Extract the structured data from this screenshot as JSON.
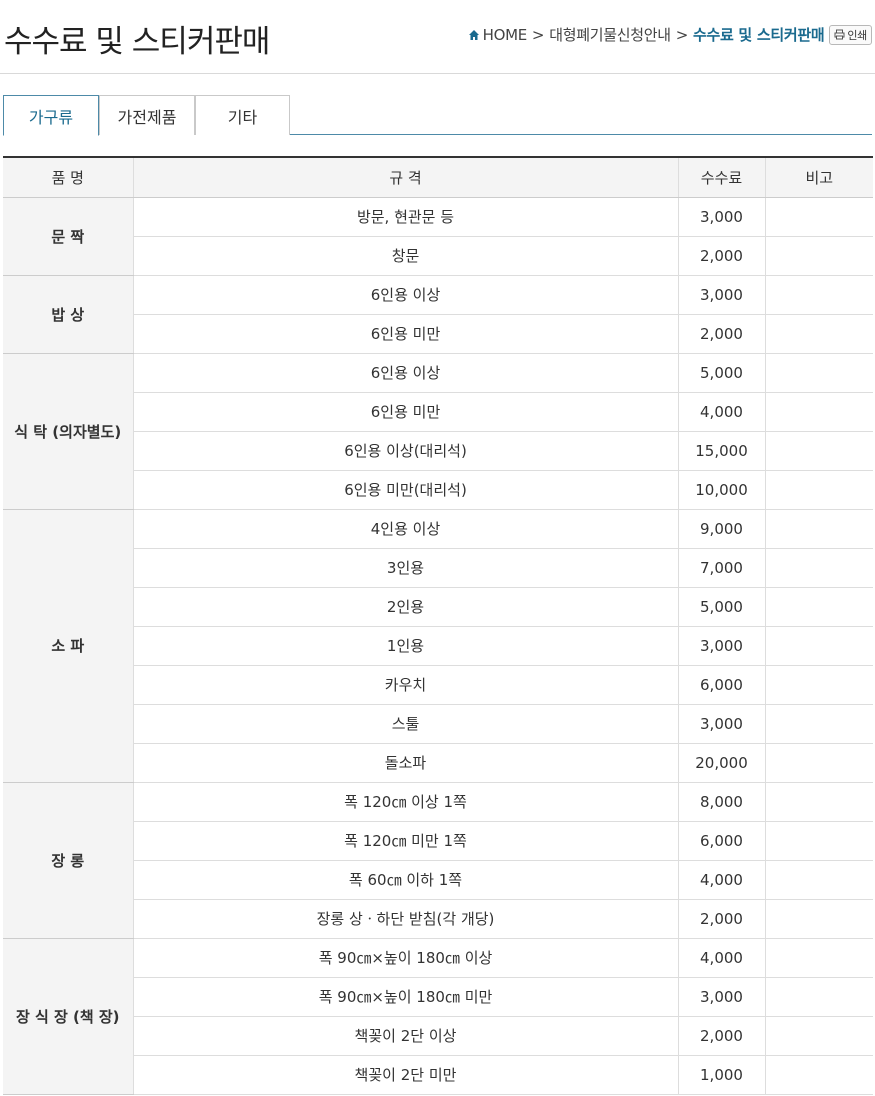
{
  "header": {
    "title": "수수료 및 스티커판매",
    "breadcrumb": {
      "home": "HOME",
      "sep1": ">",
      "parent": "대형폐기물신청안내",
      "sep2": ">",
      "current": "수수료 및 스티커판매"
    },
    "print_label": "인쇄"
  },
  "tabs": [
    {
      "label": "가구류",
      "active": true
    },
    {
      "label": "가전제품",
      "active": false
    },
    {
      "label": "기타",
      "active": false
    }
  ],
  "table": {
    "headers": [
      "품 명",
      "규 격",
      "수수료",
      "비고"
    ],
    "groups": [
      {
        "name": "문 짝",
        "rows": [
          {
            "spec": "방문, 현관문 등",
            "fee": "3,000",
            "note": ""
          },
          {
            "spec": "창문",
            "fee": "2,000",
            "note": ""
          }
        ]
      },
      {
        "name": "밥 상",
        "rows": [
          {
            "spec": "6인용 이상",
            "fee": "3,000",
            "note": ""
          },
          {
            "spec": "6인용 미만",
            "fee": "2,000",
            "note": ""
          }
        ]
      },
      {
        "name": "식 탁 (의자별도)",
        "rows": [
          {
            "spec": "6인용 이상",
            "fee": "5,000",
            "note": ""
          },
          {
            "spec": "6인용 미만",
            "fee": "4,000",
            "note": ""
          },
          {
            "spec": "6인용 이상(대리석)",
            "fee": "15,000",
            "note": ""
          },
          {
            "spec": "6인용 미만(대리석)",
            "fee": "10,000",
            "note": ""
          }
        ]
      },
      {
        "name": "소 파",
        "rows": [
          {
            "spec": "4인용 이상",
            "fee": "9,000",
            "note": ""
          },
          {
            "spec": "3인용",
            "fee": "7,000",
            "note": ""
          },
          {
            "spec": "2인용",
            "fee": "5,000",
            "note": ""
          },
          {
            "spec": "1인용",
            "fee": "3,000",
            "note": ""
          },
          {
            "spec": "카우치",
            "fee": "6,000",
            "note": ""
          },
          {
            "spec": "스툴",
            "fee": "3,000",
            "note": ""
          },
          {
            "spec": "돌소파",
            "fee": "20,000",
            "note": ""
          }
        ]
      },
      {
        "name": "장 롱",
        "rows": [
          {
            "spec": "폭 120㎝ 이상 1쪽",
            "fee": "8,000",
            "note": ""
          },
          {
            "spec": "폭 120㎝ 미만 1쪽",
            "fee": "6,000",
            "note": ""
          },
          {
            "spec": "폭 60㎝ 이하 1쪽",
            "fee": "4,000",
            "note": ""
          },
          {
            "spec": "장롱 상ㆍ하단 받침(각 개당)",
            "fee": "2,000",
            "note": ""
          }
        ]
      },
      {
        "name": "장 식 장 (책 장)",
        "rows": [
          {
            "spec": "폭 90㎝×높이 180㎝ 이상",
            "fee": "4,000",
            "note": ""
          },
          {
            "spec": "폭 90㎝×높이 180㎝ 미만",
            "fee": "3,000",
            "note": ""
          },
          {
            "spec": "책꽂이 2단 이상",
            "fee": "2,000",
            "note": ""
          },
          {
            "spec": "책꽂이 2단 미만",
            "fee": "1,000",
            "note": ""
          }
        ]
      }
    ]
  }
}
